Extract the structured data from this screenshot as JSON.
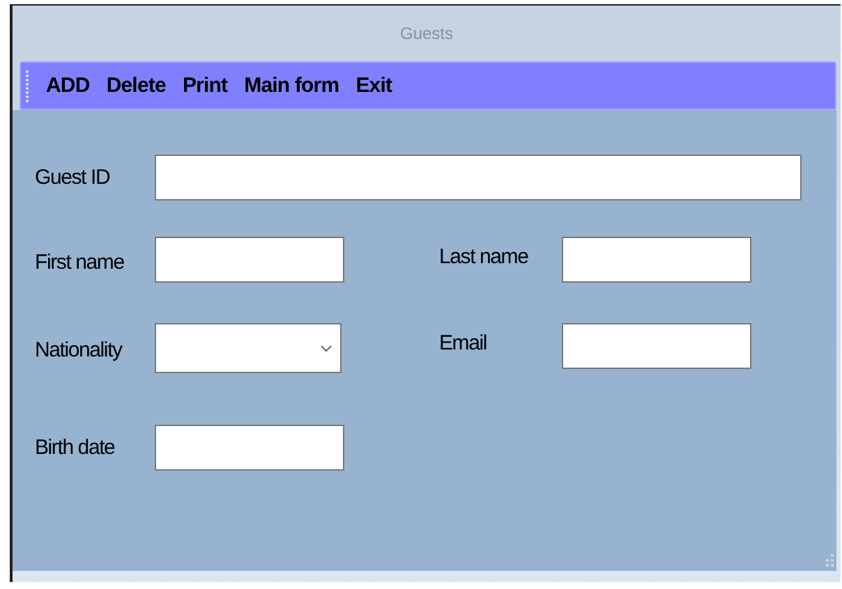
{
  "window": {
    "title": "Guests"
  },
  "toolbar": [
    "ADD",
    "Delete",
    "Print",
    "Main form",
    "Exit"
  ],
  "form_rows": [
    [
      {
        "label": "Guest ID",
        "kind": "wide_text"
      }
    ],
    [
      {
        "label": "First name",
        "kind": "text"
      },
      {
        "label": "Last name",
        "kind": "text"
      }
    ],
    [
      {
        "label": "Nationality",
        "kind": "combo"
      },
      {
        "label": "Email",
        "kind": "text"
      }
    ],
    [
      {
        "label": "Birth date",
        "kind": "text"
      }
    ]
  ]
}
